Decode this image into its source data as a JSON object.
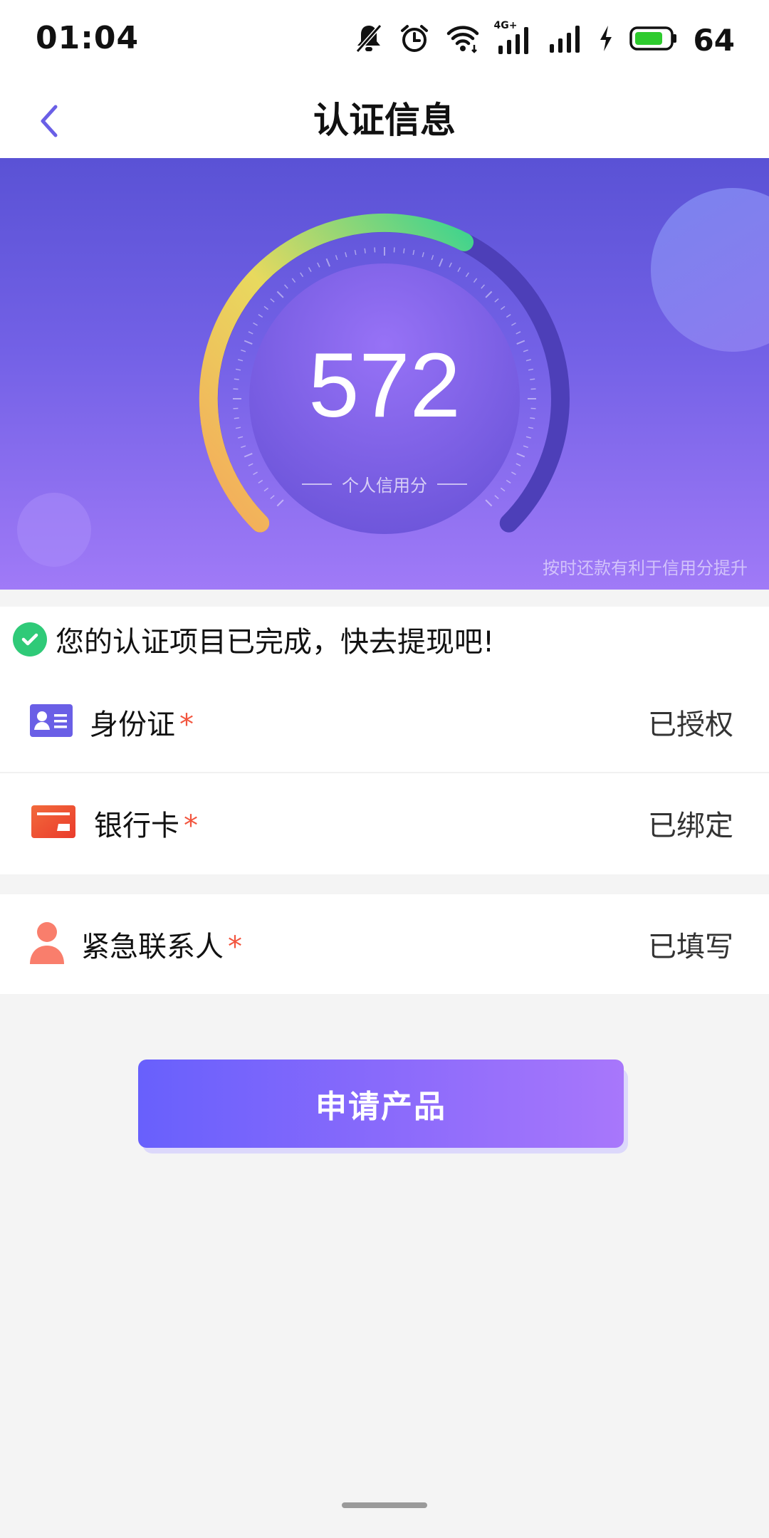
{
  "status_bar": {
    "time": "01:04",
    "network": "4G+",
    "battery": "64",
    "icons": [
      "mute-bell-icon",
      "alarm-icon",
      "wifi-icon",
      "signal-4g-icon",
      "signal-icon",
      "charging-icon",
      "battery-icon"
    ]
  },
  "nav": {
    "title": "认证信息",
    "back_icon": "chevron-left-icon"
  },
  "credit": {
    "score": "572",
    "label": "个人信用分",
    "hint": "按时还款有利于信用分提升",
    "gauge_fill_fraction": 0.6,
    "colors": {
      "start": "#f5a95a",
      "mid": "#e8d95e",
      "end": "#3ed38e",
      "track": "#4d3fb8"
    }
  },
  "notice": {
    "text": "您的认证项目已完成，快去提现吧!",
    "icon": "check-circle-icon",
    "icon_color": "#2fca78"
  },
  "items": [
    {
      "label": "身份证",
      "required": "*",
      "status": "已授权",
      "icon": "id-card-icon"
    },
    {
      "label": "银行卡",
      "required": "*",
      "status": "已绑定",
      "icon": "bank-card-icon"
    },
    {
      "label": "紧急联系人",
      "required": "*",
      "status": "已填写",
      "icon": "person-icon"
    }
  ],
  "apply_button": {
    "label": "申请产品"
  }
}
